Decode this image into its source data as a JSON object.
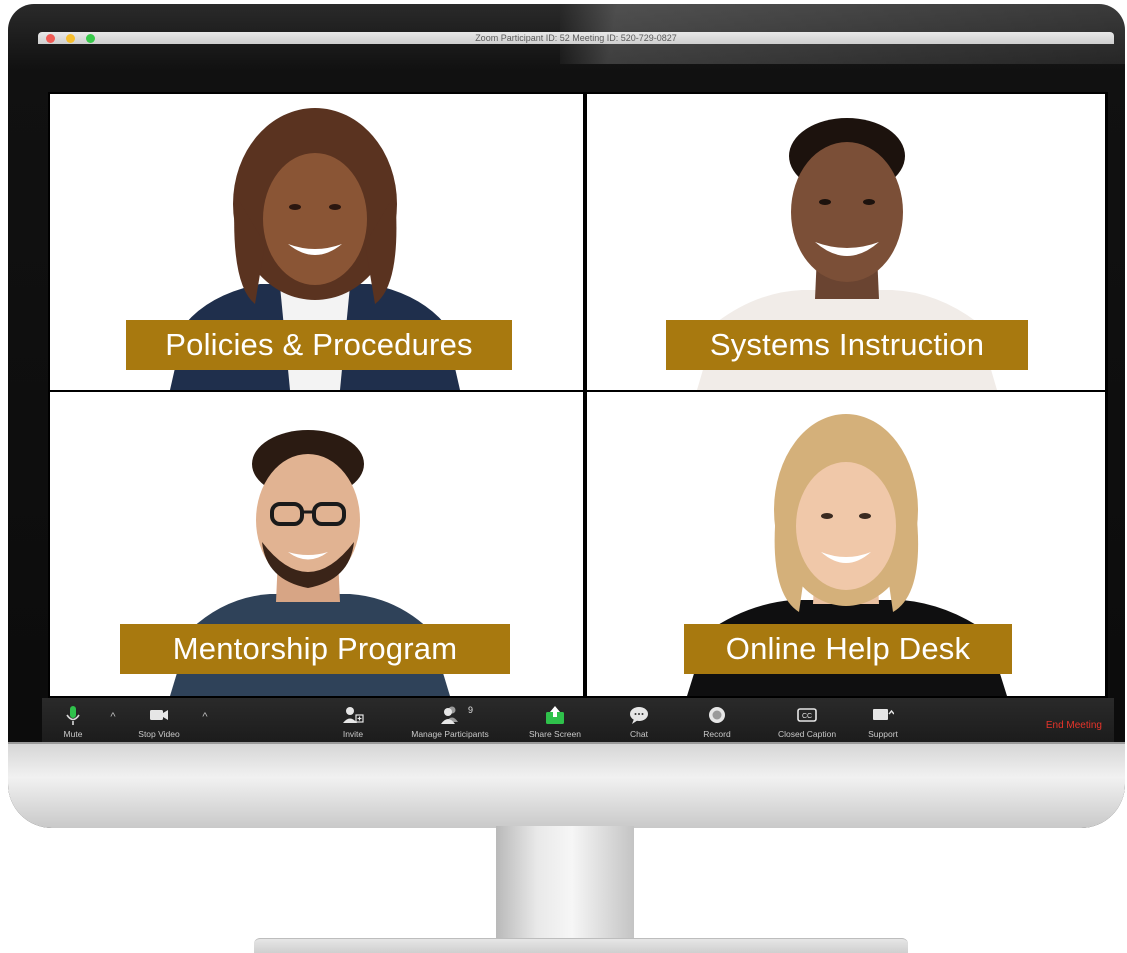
{
  "window": {
    "title": "Zoom Participant ID: 52   Meeting ID: 520-729-0827"
  },
  "tiles": [
    {
      "label": "Policies & Procedures"
    },
    {
      "label": "Systems Instruction"
    },
    {
      "label": "Mentorship Program"
    },
    {
      "label": "Online Help Desk"
    }
  ],
  "toolbar": {
    "mute_label": "Mute",
    "stop_video_label": "Stop Video",
    "invite_label": "Invite",
    "manage_participants_label": "Manage Participants",
    "participant_count": "9",
    "share_screen_label": "Share Screen",
    "chat_label": "Chat",
    "record_label": "Record",
    "closed_caption_label": "Closed Caption",
    "support_label": "Support",
    "end_meeting_label": "End Meeting"
  },
  "colors": {
    "label_bg": "#a8790f",
    "share_green": "#2fc14b",
    "end_red": "#e7342a"
  }
}
